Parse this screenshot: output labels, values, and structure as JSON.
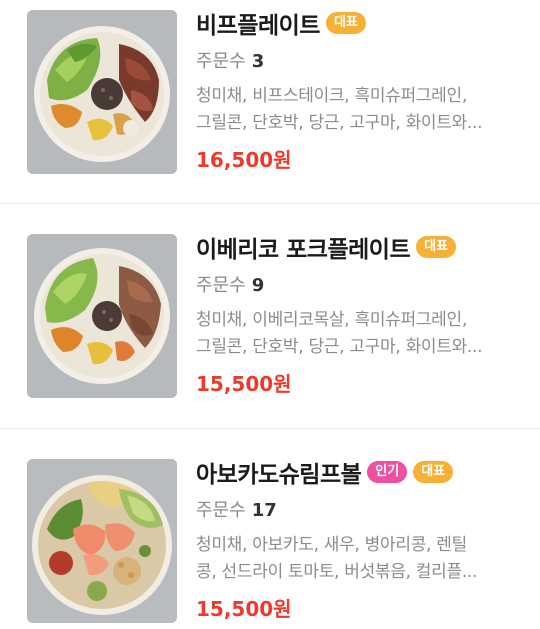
{
  "menu": {
    "items": [
      {
        "name": "비프플레이트",
        "badges": [
          {
            "label": "대표",
            "kind": "rep",
            "color": "#f6b036"
          }
        ],
        "orders_label": "주문수",
        "orders_count": "3",
        "desc_line1": "청미채, 비프스테이크, 흑미슈퍼그레인,",
        "desc_line2": "그릴콘, 단호박, 당근, 고구마, 화이트와...",
        "price": "16,500원",
        "image": "beef-salad-bowl"
      },
      {
        "name": "이베리코 포크플레이트",
        "badges": [
          {
            "label": "대표",
            "kind": "rep",
            "color": "#f6b036"
          }
        ],
        "orders_label": "주문수",
        "orders_count": "9",
        "desc_line1": "청미채, 이베리코목살, 흑미슈퍼그레인,",
        "desc_line2": "그릴콘, 단호박, 당근, 고구마, 화이트와...",
        "price": "15,500원",
        "image": "pork-salad-bowl"
      },
      {
        "name": "아보카도슈림프볼",
        "badges": [
          {
            "label": "인기",
            "kind": "pop",
            "color": "#ee4fa0"
          },
          {
            "label": "대표",
            "kind": "rep",
            "color": "#f6b036"
          }
        ],
        "orders_label": "주문수",
        "orders_count": "17",
        "desc_line1": "청미채, 아보카도, 새우, 병아리콩, 렌틸",
        "desc_line2": "콩, 선드라이 토마토, 버섯볶음, 컬리플...",
        "price": "15,500원",
        "image": "avocado-shrimp-bowl"
      }
    ]
  },
  "colors": {
    "price": "#ec3b2b",
    "badge_rep": "#f6b036",
    "badge_pop": "#ee4fa0"
  }
}
